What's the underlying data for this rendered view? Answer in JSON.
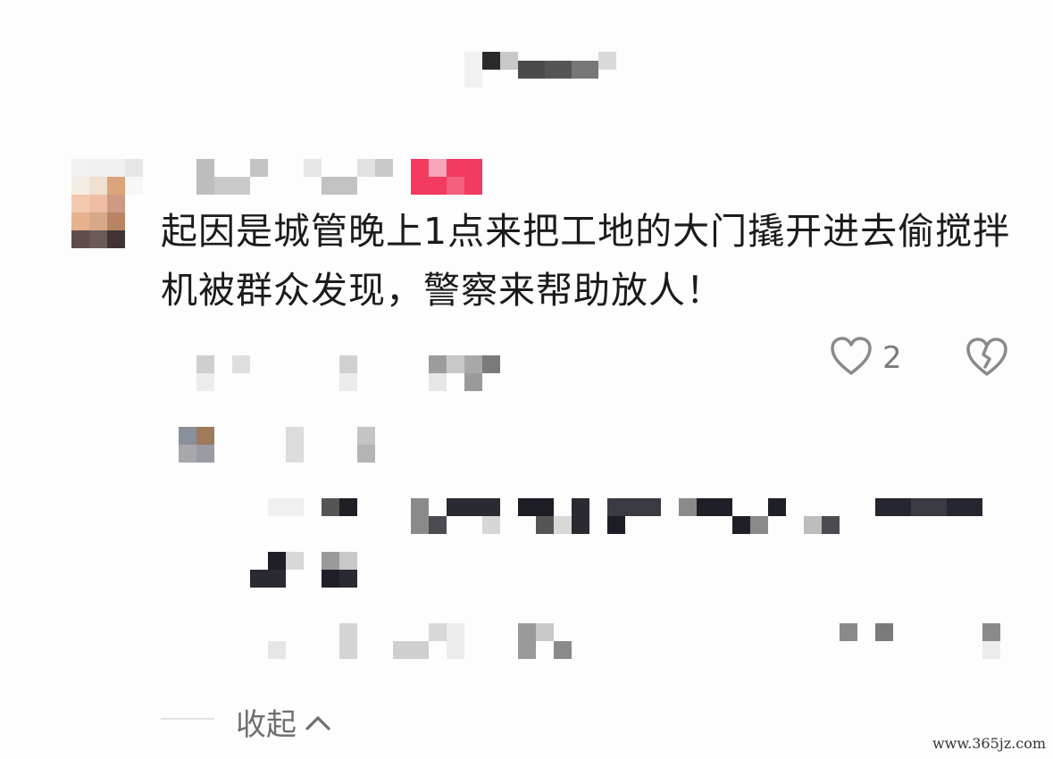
{
  "header": {
    "title_obscured": true
  },
  "comment": {
    "text": "起因是城管晚上1点来把工地的大门撬开进去偷搅拌机被群众发现，警察来帮助放人！",
    "like_count": "2",
    "like_icon": "heart-outline-icon",
    "dislike_icon": "broken-heart-icon"
  },
  "footer": {
    "collapse_label": "收起",
    "collapse_icon": "chevron-up-icon"
  },
  "watermark": "www.365jz.com",
  "colors": {
    "accent_badge": "#f33a5f",
    "text_primary": "#1b1b1b",
    "text_secondary": "#7b7b7b"
  }
}
